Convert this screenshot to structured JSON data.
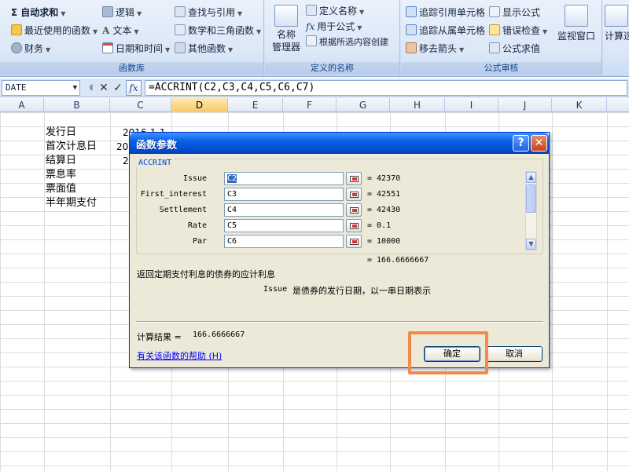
{
  "ribbon": {
    "function_library": {
      "autosum": "自动求和",
      "recent": "最近使用的函数",
      "financial": "财务",
      "logical": "逻辑",
      "text": "文本",
      "datetime": "日期和时间",
      "lookup": "查找与引用",
      "math": "数学和三角函数",
      "more": "其他函数",
      "title": "函数库"
    },
    "defined_names": {
      "name_manager": [
        "名称",
        "管理器"
      ],
      "define_name": "定义名称",
      "use_in_formula": "用于公式",
      "create_from_selection": "根据所选内容创建",
      "title": "定义的名称"
    },
    "formula_auditing": {
      "trace_precedents": "追踪引用单元格",
      "trace_dependents": "追踪从属单元格",
      "remove_arrows": "移去箭头",
      "show_formulas": "显示公式",
      "error_checking": "错误检查",
      "evaluate_formula": "公式求值",
      "watch_window": "监视窗口",
      "title": "公式审核"
    },
    "calculation": {
      "options": "计算选"
    }
  },
  "formula_bar": {
    "name_box": "DATE",
    "cancel": "✕",
    "enter": "✓",
    "fx": "fx",
    "formula": "=ACCRINT(C2,C3,C4,C5,C6,C7)"
  },
  "columns": [
    "A",
    "B",
    "C",
    "D",
    "E",
    "F",
    "G",
    "H",
    "I",
    "J",
    "K"
  ],
  "selected_column": "D",
  "cells": {
    "b2": "发行日",
    "b3": "首次计息日",
    "b4": "结算日",
    "b5": "票息率",
    "b6": "票面值",
    "b7": "半年期支付",
    "c2": "2016-1-1",
    "c3": "20",
    "c4": "2"
  },
  "dialog": {
    "title": "函数参数",
    "help_glyph": "?",
    "close_glyph": "✕",
    "function_name": "ACCRINT",
    "args": [
      {
        "label": "Issue",
        "ref": "C2",
        "value": "= 42370"
      },
      {
        "label": "First_interest",
        "ref": "C3",
        "value": "= 42551"
      },
      {
        "label": "Settlement",
        "ref": "C4",
        "value": "= 42430"
      },
      {
        "label": "Rate",
        "ref": "C5",
        "value": "= 0.1"
      },
      {
        "label": "Par",
        "ref": "C6",
        "value": "= 10000"
      }
    ],
    "result_inline": "= 166.6666667",
    "description": "返回定期支付利息的债券的应计利息",
    "arg_name": "Issue",
    "arg_description": "是债券的发行日期，以一串日期表示",
    "calc_result_label": "计算结果 =",
    "calc_result_value": "166.6666667",
    "help_link": "有关该函数的帮助 (H)",
    "ok_label": "确定",
    "cancel_label": "取消"
  },
  "colors": {
    "highlight": "#f28a4f",
    "title_bar": "#0a5fe6",
    "selected_column": "#f9c86a"
  }
}
